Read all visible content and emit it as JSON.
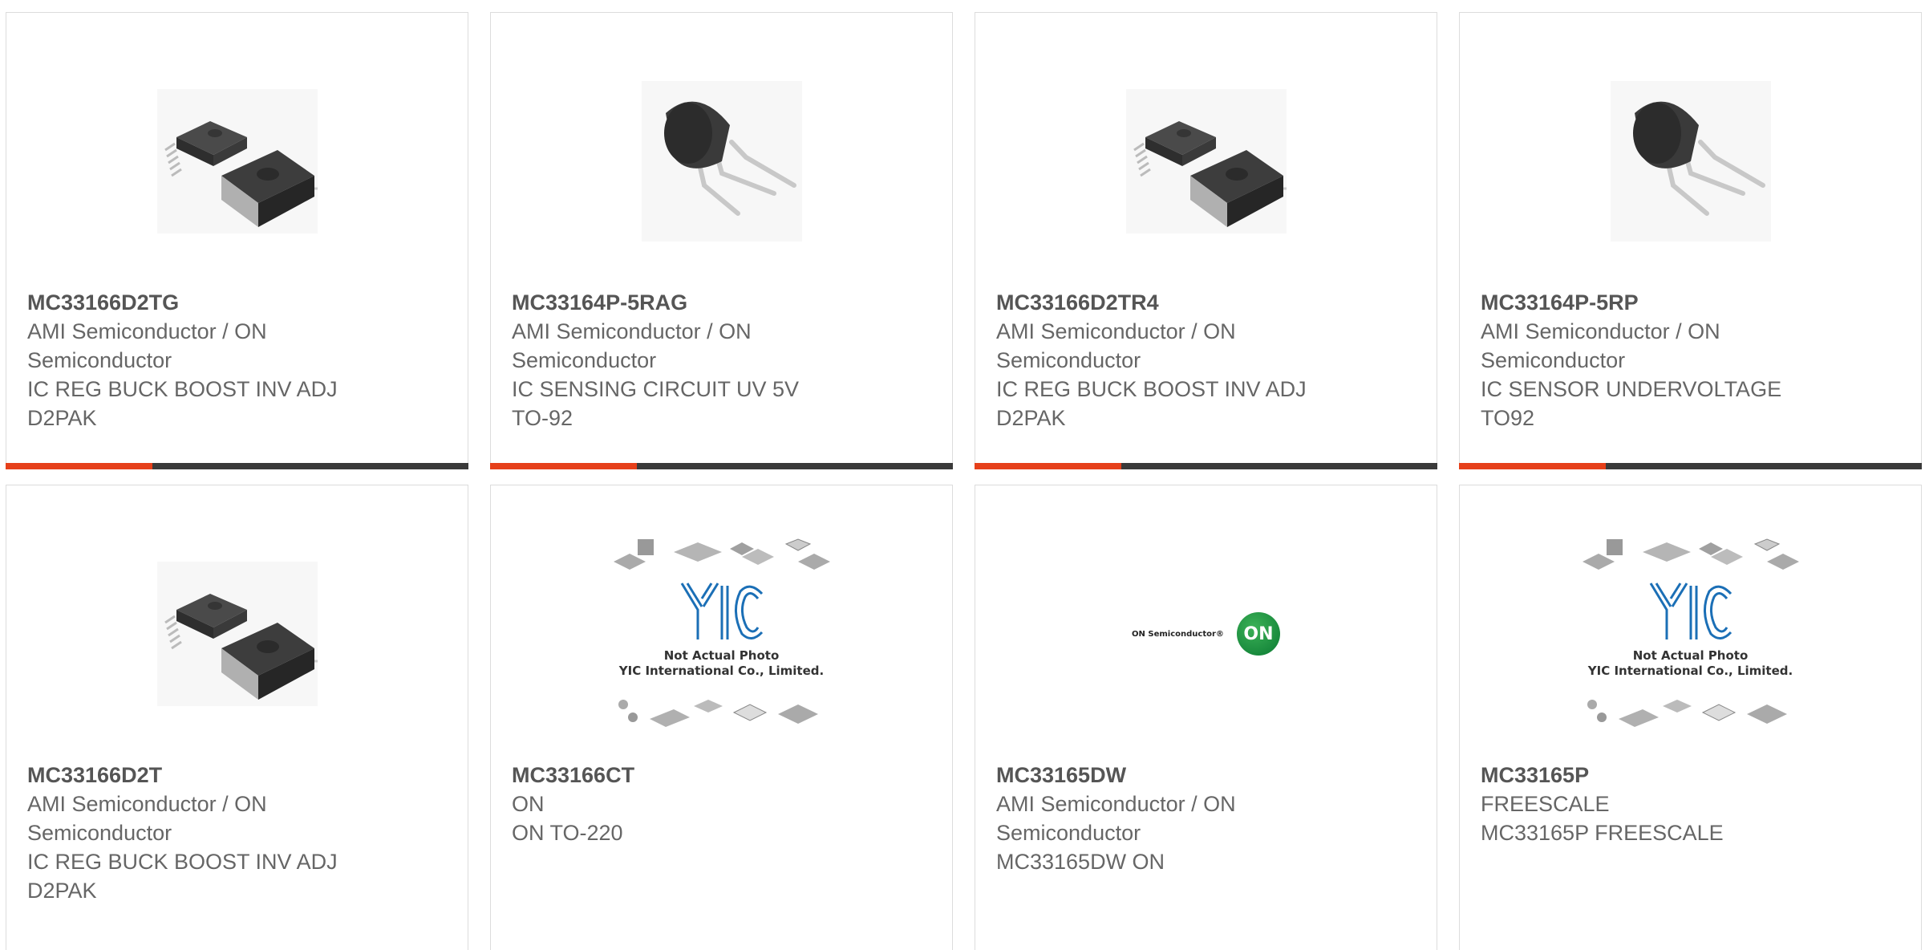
{
  "products": [
    {
      "part": "MC33166D2TG",
      "mfr": "AMI Semiconductor / ON Semiconductor",
      "desc1": "IC REG BUCK BOOST INV ADJ",
      "desc2": "D2PAK",
      "image": "d2pak-package-icon"
    },
    {
      "part": "MC33164P-5RAG",
      "mfr": "AMI Semiconductor / ON Semiconductor",
      "desc1": "IC SENSING CIRCUIT UV 5V",
      "desc2": "TO-92",
      "image": "to92-package-icon"
    },
    {
      "part": "MC33166D2TR4",
      "mfr": "AMI Semiconductor / ON Semiconductor",
      "desc1": "IC REG BUCK BOOST INV ADJ",
      "desc2": "D2PAK",
      "image": "d2pak-package-icon"
    },
    {
      "part": "MC33164P-5RP",
      "mfr": "AMI Semiconductor / ON Semiconductor",
      "desc1": "IC SENSOR UNDERVOLTAGE",
      "desc2": "TO92",
      "image": "to92-package-icon"
    },
    {
      "part": "MC33166D2T",
      "mfr": "AMI Semiconductor / ON Semiconductor",
      "desc1": "IC REG BUCK BOOST INV ADJ",
      "desc2": "D2PAK",
      "image": "d2pak-package-icon"
    },
    {
      "part": "MC33166CT",
      "mfr": "ON",
      "desc1": "ON TO-220",
      "desc2": "",
      "image": "yic-placeholder-image",
      "placeholder_line1": "Not Actual Photo",
      "placeholder_line2": "YIC International Co., Limited."
    },
    {
      "part": "MC33165DW",
      "mfr": "AMI Semiconductor / ON Semiconductor",
      "desc1": "MC33165DW ON",
      "desc2": "",
      "image": "on-semiconductor-logo",
      "logo_text": "ON Semiconductor®",
      "logo_mark": "ON"
    },
    {
      "part": "MC33165P",
      "mfr": "FREESCALE",
      "desc1": "MC33165P FREESCALE",
      "desc2": "",
      "image": "yic-placeholder-image",
      "placeholder_line1": "Not Actual Photo",
      "placeholder_line2": "YIC International Co., Limited."
    }
  ],
  "colors": {
    "accent": "#e6401a",
    "bar": "#3a3a3a",
    "text": "#666666"
  }
}
